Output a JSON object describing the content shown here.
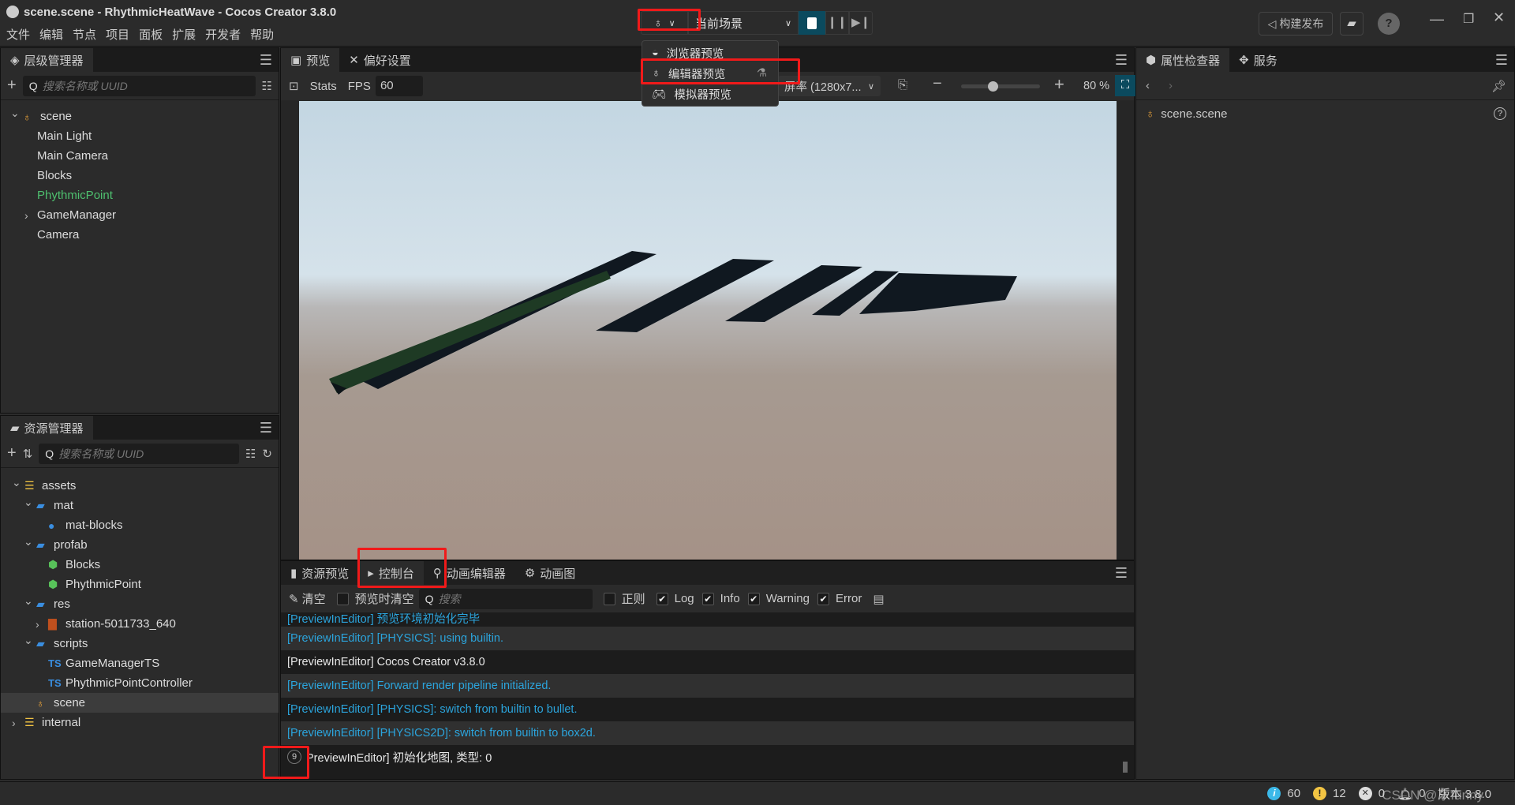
{
  "window": {
    "title": "scene.scene - RhythmicHeatWave - Cocos Creator 3.8.0",
    "menu": [
      "文件",
      "编辑",
      "节点",
      "项目",
      "面板",
      "扩展",
      "开发者",
      "帮助"
    ]
  },
  "toolbar": {
    "scene_select": "当前场景",
    "build_label": "构建发布",
    "accent": "#0b4a5e"
  },
  "preview_menu": {
    "items": [
      {
        "label": "浏览器预览",
        "icon": "browser-icon"
      },
      {
        "label": "编辑器预览",
        "icon": "cocos-icon"
      },
      {
        "label": "模拟器预览",
        "icon": "gamepad-icon"
      }
    ]
  },
  "hierarchy": {
    "title": "层级管理器",
    "search_placeholder": "搜索名称或 UUID",
    "items": [
      {
        "label": "scene",
        "depth": 0,
        "arrow": "down",
        "icon": "cocos"
      },
      {
        "label": "Main Light",
        "depth": 1
      },
      {
        "label": "Main Camera",
        "depth": 1
      },
      {
        "label": "Blocks",
        "depth": 1
      },
      {
        "label": "PhythmicPoint",
        "depth": 1,
        "color": "#4ec06f"
      },
      {
        "label": "GameManager",
        "depth": 1,
        "arrow": "right"
      },
      {
        "label": "Camera",
        "depth": 1
      }
    ]
  },
  "assets": {
    "title": "资源管理器",
    "search_placeholder": "搜索名称或 UUID",
    "items": [
      {
        "label": "assets",
        "depth": 0,
        "arrow": "down",
        "icon": "db"
      },
      {
        "label": "mat",
        "depth": 1,
        "arrow": "down",
        "icon": "folder"
      },
      {
        "label": "mat-blocks",
        "depth": 2,
        "icon": "material"
      },
      {
        "label": "profab",
        "depth": 1,
        "arrow": "down",
        "icon": "folder"
      },
      {
        "label": "Blocks",
        "depth": 2,
        "icon": "prefab"
      },
      {
        "label": "PhythmicPoint",
        "depth": 2,
        "icon": "prefab"
      },
      {
        "label": "res",
        "depth": 1,
        "arrow": "down",
        "icon": "folder"
      },
      {
        "label": "station-5011733_640",
        "depth": 2,
        "arrow": "right",
        "icon": "image"
      },
      {
        "label": "scripts",
        "depth": 1,
        "arrow": "down",
        "icon": "folder"
      },
      {
        "label": "GameManagerTS",
        "depth": 2,
        "icon": "ts"
      },
      {
        "label": "PhythmicPointController",
        "depth": 2,
        "icon": "ts"
      },
      {
        "label": "scene",
        "depth": 1,
        "icon": "cocos",
        "selected": true
      },
      {
        "label": "internal",
        "depth": 0,
        "arrow": "right",
        "icon": "db"
      }
    ]
  },
  "preview": {
    "tabs": [
      "预览",
      "偏好设置"
    ],
    "stats": "Stats",
    "fps_label": "FPS",
    "fps": "60",
    "resolution": "屏率 (1280x7...",
    "zoom": "80 %",
    "zoom_level": 0.4
  },
  "bottom": {
    "tabs": [
      "资源预览",
      "控制台",
      "动画编辑器",
      "动画图"
    ],
    "active_tab": 1,
    "clear": "清空",
    "clear_on_preview": "预览时清空",
    "search_placeholder": "搜索",
    "regex": "正则",
    "filters": [
      {
        "label": "Log",
        "checked": true
      },
      {
        "label": "Info",
        "checked": true
      },
      {
        "label": "Warning",
        "checked": true
      },
      {
        "label": "Error",
        "checked": true
      }
    ],
    "logs": [
      {
        "text": "[PreviewInEditor] 预览环境初始化完毕",
        "color": "#2ba4dc"
      },
      {
        "text": "[PreviewInEditor] [PHYSICS]: using builtin.",
        "color": "#2ba4dc"
      },
      {
        "text": "[PreviewInEditor] Cocos Creator v3.8.0",
        "color": "#e8e8e8"
      },
      {
        "text": "[PreviewInEditor] Forward render pipeline initialized.",
        "color": "#2ba4dc"
      },
      {
        "text": "[PreviewInEditor] [PHYSICS]: switch from builtin to bullet.",
        "color": "#2ba4dc"
      },
      {
        "text": "[PreviewInEditor] [PHYSICS2D]: switch from builtin to box2d.",
        "color": "#2ba4dc"
      },
      {
        "text": "PreviewInEditor] 初始化地图, 类型:  0",
        "color": "#e8e8e8",
        "count": "9"
      }
    ]
  },
  "inspector": {
    "tabs": [
      "属性检查器",
      "服务"
    ],
    "item": "scene.scene"
  },
  "status": {
    "info": "60",
    "warn": "12",
    "error": "0",
    "bell": "0",
    "version": "版本 3.8.0",
    "watermark": "CSDN @东funny"
  }
}
